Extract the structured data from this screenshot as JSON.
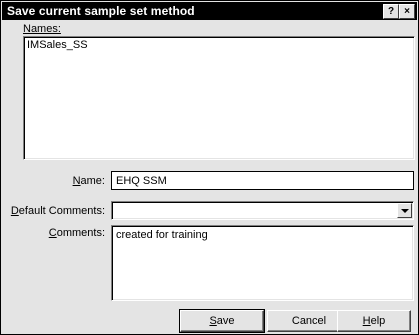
{
  "dialog": {
    "title": "Save current sample set method",
    "help_button": "?",
    "close_button": "×"
  },
  "names": {
    "label": "Names:",
    "items": [
      "IMSales_SS"
    ]
  },
  "name_field": {
    "label": "Name:",
    "value": "EHQ SSM"
  },
  "default_comments": {
    "label": "Default Comments:",
    "value": ""
  },
  "comments": {
    "label": "Comments:",
    "value": "created for training"
  },
  "buttons": {
    "save": "Save",
    "cancel": "Cancel",
    "help": "Help"
  },
  "icons": {
    "dropdown": "chevron-down-icon",
    "help": "question-icon",
    "close": "close-icon"
  }
}
